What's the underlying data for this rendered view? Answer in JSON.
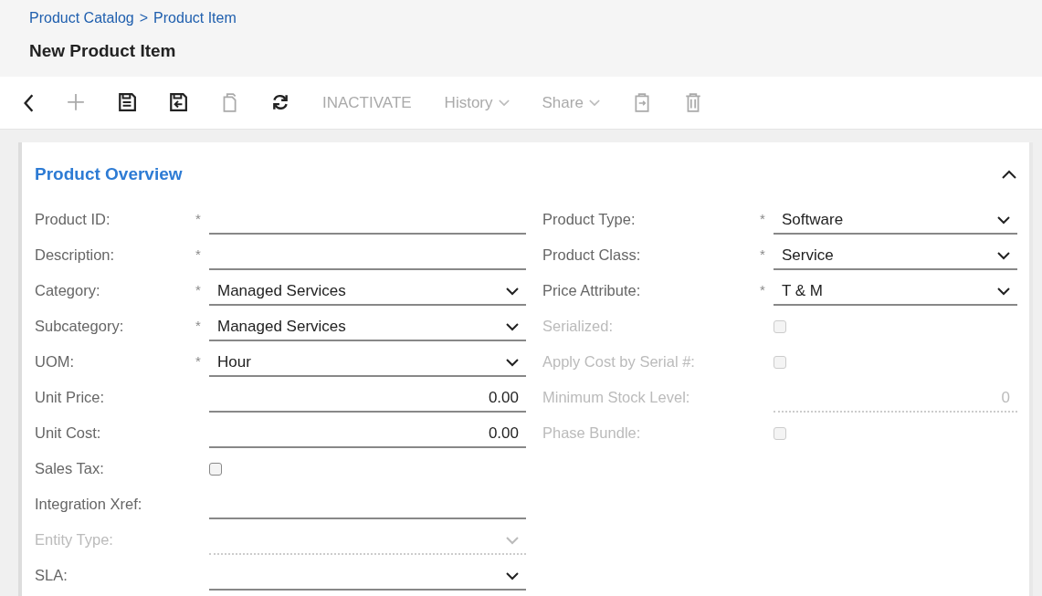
{
  "breadcrumb": {
    "parent": "Product Catalog",
    "separator": ">",
    "current": "Product Item"
  },
  "title": "New Product Item",
  "toolbar": [
    {
      "kind": "back",
      "disabled": false
    },
    {
      "kind": "add",
      "disabled": true
    },
    {
      "kind": "save",
      "disabled": false
    },
    {
      "kind": "saveclose",
      "disabled": false
    },
    {
      "kind": "copy",
      "disabled": true
    },
    {
      "kind": "refresh",
      "disabled": false
    },
    {
      "kind": "action",
      "label": "INACTIVATE",
      "disabled": true
    },
    {
      "kind": "menu",
      "label": "History",
      "disabled": true
    },
    {
      "kind": "menu",
      "label": "Share",
      "disabled": true
    },
    {
      "kind": "clipboard",
      "disabled": true
    },
    {
      "kind": "delete",
      "disabled": true
    }
  ],
  "section": {
    "title": "Product Overview",
    "expanded": true,
    "left": [
      {
        "kind": "text",
        "label": "Product ID:",
        "required_mark": "*",
        "disabled": false
      },
      {
        "kind": "text",
        "label": "Description:",
        "required_mark": "*",
        "disabled": false
      },
      {
        "kind": "select",
        "label": "Category:",
        "required_mark": "*",
        "value": "Managed Services",
        "disabled": false
      },
      {
        "kind": "select",
        "label": "Subcategory:",
        "required_mark": "*",
        "value": "Managed Services",
        "disabled": false
      },
      {
        "kind": "select",
        "label": "UOM:",
        "required_mark": "*",
        "value": "Hour",
        "disabled": false
      },
      {
        "kind": "number",
        "label": "Unit Price:",
        "value": "0.00",
        "disabled": false
      },
      {
        "kind": "number",
        "label": "Unit Cost:",
        "value": "0.00",
        "disabled": false
      },
      {
        "kind": "checkbox",
        "label": "Sales Tax:",
        "checked": false,
        "disabled": false
      },
      {
        "kind": "text",
        "label": "Integration Xref:",
        "disabled": false
      },
      {
        "kind": "select",
        "label": "Entity Type:",
        "disabled": true
      },
      {
        "kind": "select",
        "label": "SLA:",
        "disabled": false
      }
    ],
    "right": [
      {
        "kind": "select",
        "label": "Product Type:",
        "required_mark": "*",
        "value": "Software",
        "disabled": false
      },
      {
        "kind": "select",
        "label": "Product Class:",
        "required_mark": "*",
        "value": "Service",
        "disabled": false
      },
      {
        "kind": "select",
        "label": "Price Attribute:",
        "required_mark": "*",
        "value": "T & M",
        "disabled": false
      },
      {
        "kind": "checkbox",
        "label": "Serialized:",
        "checked": false,
        "disabled": true
      },
      {
        "kind": "checkbox",
        "label": "Apply Cost by Serial #:",
        "checked": false,
        "disabled": true
      },
      {
        "kind": "number",
        "label": "Minimum Stock Level:",
        "value": "0",
        "disabled": true
      },
      {
        "kind": "checkbox",
        "label": "Phase Bundle:",
        "checked": false,
        "disabled": true
      }
    ]
  }
}
